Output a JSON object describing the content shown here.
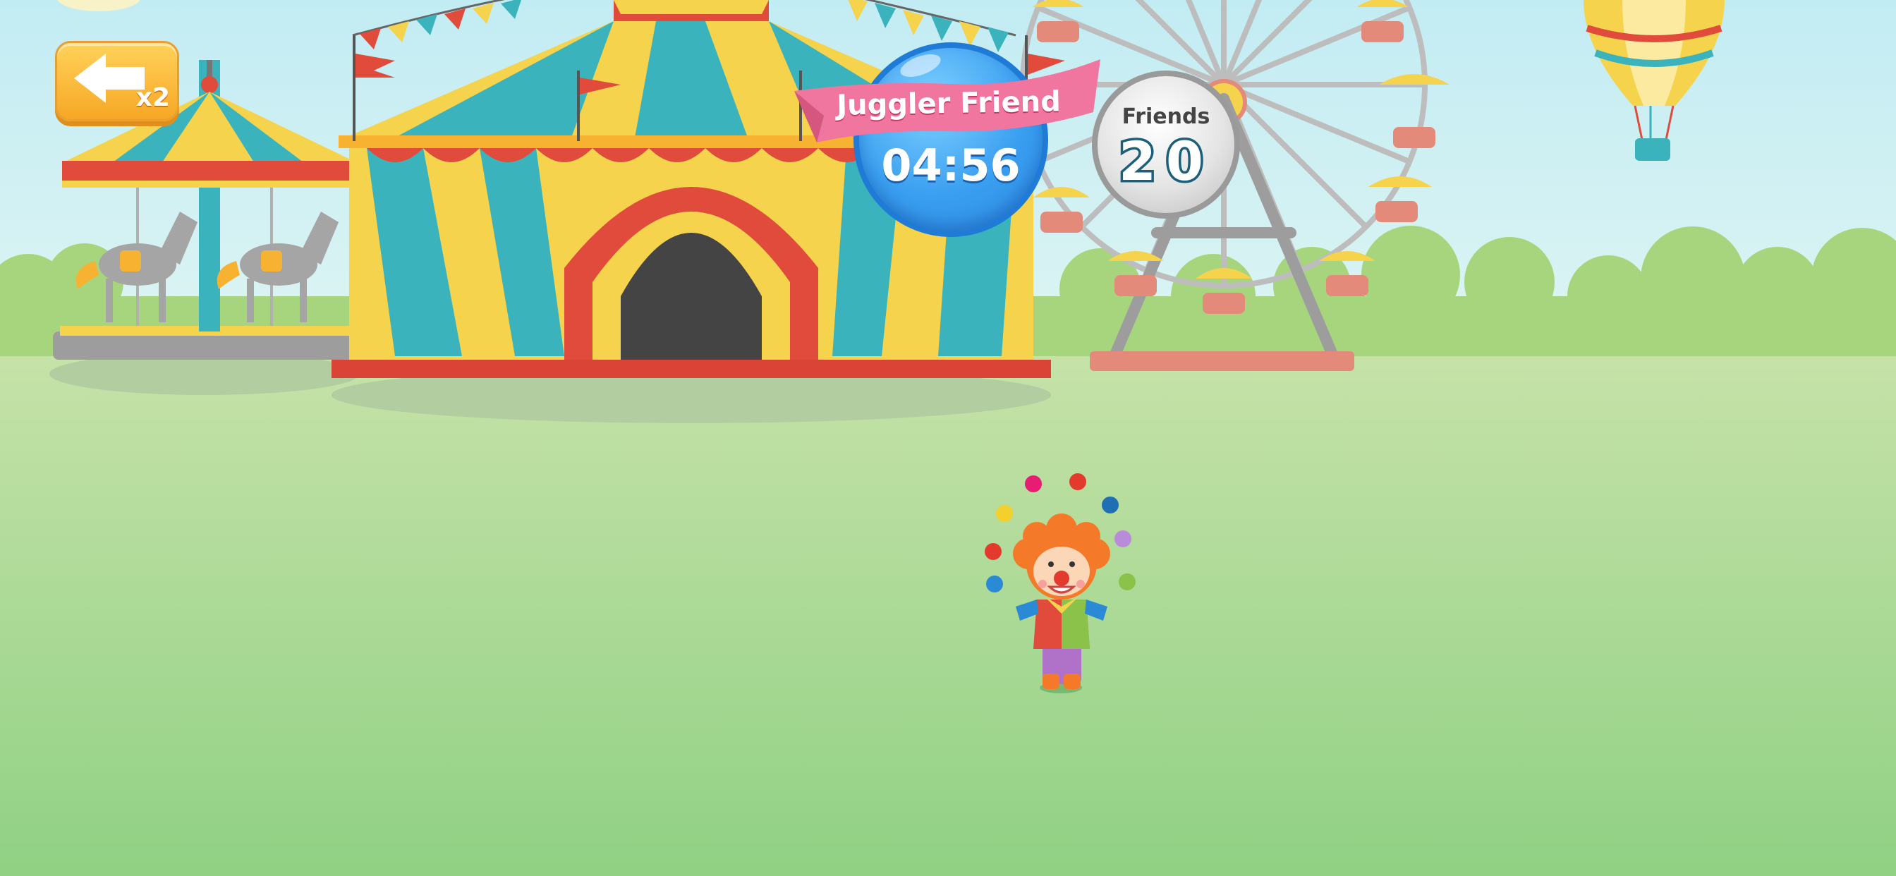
{
  "back_button": {
    "icon": "arrow-left-icon",
    "multiplier": "x2"
  },
  "challenge": {
    "title": "Juggler Friend",
    "timer": "04:56"
  },
  "friends": {
    "label": "Friends",
    "count": "20"
  },
  "colors": {
    "sky": "#c8eef2",
    "grass": "#97d48a",
    "tent_teal": "#3bb3bd",
    "tent_yellow": "#f5d34c",
    "tent_red": "#e04b3c",
    "ribbon_pink": "#f0769f",
    "timer_blue": "#3a9ff0",
    "button_orange": "#f7b232"
  },
  "juggling_ball_colors": [
    "#e61d73",
    "#e23b2e",
    "#1f6fb4",
    "#b98bd8",
    "#8ac24a",
    "#2a8ad6",
    "#e23b2e",
    "#f4d02c"
  ]
}
